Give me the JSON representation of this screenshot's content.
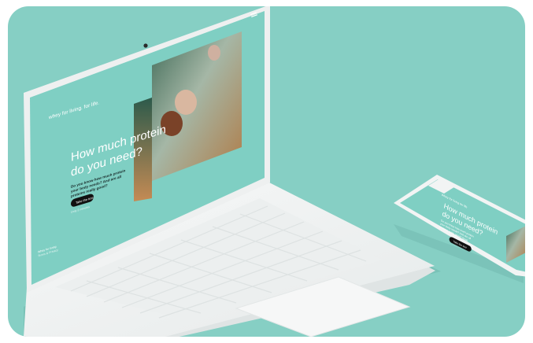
{
  "brand": {
    "tagline": "whey for living. for life."
  },
  "hero": {
    "headline_line1": "How much protein",
    "headline_line2": "do you need?",
    "body_line1": "Do you know how much protein",
    "body_line2": "your body needs? And are all",
    "body_line3": "proteins really good?",
    "cta_label": "Take the test",
    "fine_print": "Only 2 minutes"
  },
  "footer": {
    "line1": "Whey for living",
    "line2": "Terms & Privacy"
  },
  "phone": {
    "header_title": "Whey for living for life",
    "headline_line1": "How much protein",
    "headline_line2": "do you need?",
    "body_line1": "Do you know how much protein",
    "body_line2": "your body needs? And are all",
    "body_line3": "proteins really good? Read",
    "cta_label": "Take the test"
  },
  "colors": {
    "background": "#86cfc4",
    "screen_teal": "#7fcfc3",
    "laptop_body": "#f3f4f4",
    "cta": "#111111"
  },
  "icons": [
    "menu-icon",
    "camera-icon"
  ]
}
